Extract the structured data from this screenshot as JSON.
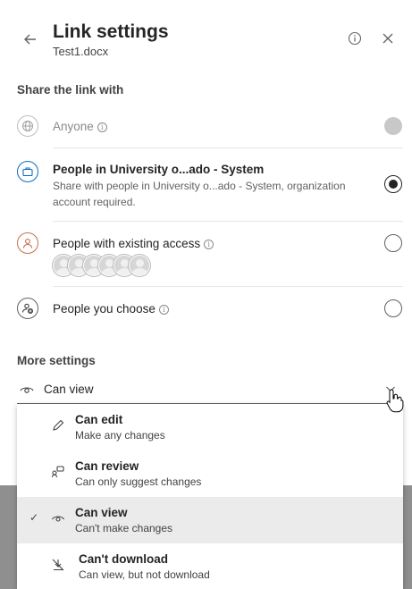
{
  "header": {
    "title": "Link settings",
    "subtitle": "Test1.docx",
    "back_icon": "arrow-left-icon",
    "info_icon": "info-icon",
    "close_icon": "close-icon"
  },
  "share": {
    "section_label": "Share the link with",
    "options": [
      {
        "name": "Anyone",
        "description": "",
        "icon": "globe-icon",
        "disabled": true,
        "selected": false,
        "has_info": true
      },
      {
        "name": "People in University o...ado - System",
        "description": "Share with people in University o...ado - System, organization account required.",
        "icon": "briefcase-icon",
        "disabled": false,
        "selected": true,
        "has_info": false
      },
      {
        "name": "People with existing access",
        "description": "",
        "icon": "person-icon",
        "disabled": false,
        "selected": false,
        "has_info": true
      },
      {
        "name": "People you choose",
        "description": "",
        "icon": "person-add-icon",
        "disabled": false,
        "selected": false,
        "has_info": true
      }
    ]
  },
  "more_settings": {
    "label": "More settings",
    "permission_value": "Can view"
  },
  "dropdown": {
    "items": [
      {
        "title": "Can edit",
        "subtitle": "Make any changes",
        "icon": "pencil-icon",
        "selected": false
      },
      {
        "title": "Can review",
        "subtitle": "Can only suggest changes",
        "icon": "review-icon",
        "selected": false
      },
      {
        "title": "Can view",
        "subtitle": "Can't make changes",
        "icon": "eye-icon",
        "selected": true
      },
      {
        "title": "Can't download",
        "subtitle": "Can view, but not download",
        "icon": "no-download-icon",
        "selected": false
      }
    ]
  },
  "colors": {
    "accent": "#0f6cbd",
    "selected_bg": "#ebebeb",
    "backdrop": "#8f8f8f"
  }
}
